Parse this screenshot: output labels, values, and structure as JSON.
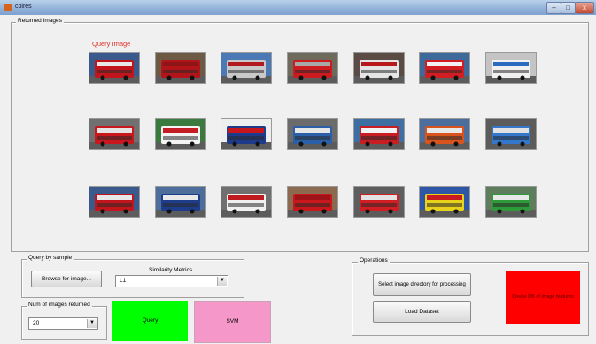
{
  "window": {
    "title": "cbires",
    "minimize": "–",
    "maximize": "□",
    "close": "x"
  },
  "returned_panel": {
    "legend": "Returned Images",
    "query_label": "Query Image"
  },
  "thumbnails": [
    {
      "colors": [
        "#c2141b",
        "#e8e8e8",
        "#3b5a8c"
      ]
    },
    {
      "colors": [
        "#b3141a",
        "#8f1416",
        "#6c5a45"
      ]
    },
    {
      "colors": [
        "#c9c9c9",
        "#b11b1f",
        "#4a79b6"
      ]
    },
    {
      "colors": [
        "#cc1c20",
        "#a8a8a8",
        "#6e6a5c"
      ]
    },
    {
      "colors": [
        "#e5e5e5",
        "#b8181c",
        "#5a4b44"
      ]
    },
    {
      "colors": [
        "#d21e23",
        "#f2f2f2",
        "#3d6a9a"
      ]
    },
    {
      "colors": [
        "#f0f0f0",
        "#2a6bc2",
        "#c4c4c4"
      ]
    },
    {
      "colors": [
        "#c8171d",
        "#e4e4e4",
        "#707070"
      ]
    },
    {
      "colors": [
        "#f4f4f4",
        "#c41e24",
        "#3b7a3f"
      ]
    },
    {
      "colors": [
        "#1e3a8a",
        "#c7161c",
        "#eeeeee"
      ]
    },
    {
      "colors": [
        "#2b5fa8",
        "#e6e6e6",
        "#6b6b6b"
      ]
    },
    {
      "colors": [
        "#c81d22",
        "#f3f3f3",
        "#3e6fa3"
      ]
    },
    {
      "colors": [
        "#d9531d",
        "#e8e8e8",
        "#4b6e9c"
      ]
    },
    {
      "colors": [
        "#3476c9",
        "#e1e1e1",
        "#5b5b5b"
      ]
    },
    {
      "colors": [
        "#c2141b",
        "#e8e8e8",
        "#3b5a8c"
      ]
    },
    {
      "colors": [
        "#1d3d8a",
        "#e9e9e9",
        "#4d6d9a"
      ]
    },
    {
      "colors": [
        "#f0f0f0",
        "#bf1a1e",
        "#707070"
      ]
    },
    {
      "colors": [
        "#c9171c",
        "#9c1318",
        "#8b6a50"
      ]
    },
    {
      "colors": [
        "#d01e22",
        "#e3e3e3",
        "#5e5e5e"
      ]
    },
    {
      "colors": [
        "#e8d21a",
        "#c81b21",
        "#2e56a6"
      ]
    },
    {
      "colors": [
        "#2e9a3a",
        "#e8e8e8",
        "#5d7d5d"
      ]
    }
  ],
  "query_panel": {
    "legend": "Query by sample",
    "browse_label": "Browse for image...",
    "metrics_label": "Similarity Metrics",
    "metric_value": "L1",
    "dropdown_arrow": "▼"
  },
  "num_panel": {
    "legend": "Num of images returned",
    "value": "20",
    "dropdown_arrow": "▼"
  },
  "query_button": {
    "label": "Query",
    "color": "#00ff00"
  },
  "svm_button": {
    "label": "SVM",
    "color": "#f598c9"
  },
  "operations": {
    "legend": "Operations",
    "select_dir_label": "Select image directory for processing",
    "load_label": "Load Dataset",
    "create_db_label": "Create DB of image features",
    "create_db_color": "#ff0000"
  }
}
